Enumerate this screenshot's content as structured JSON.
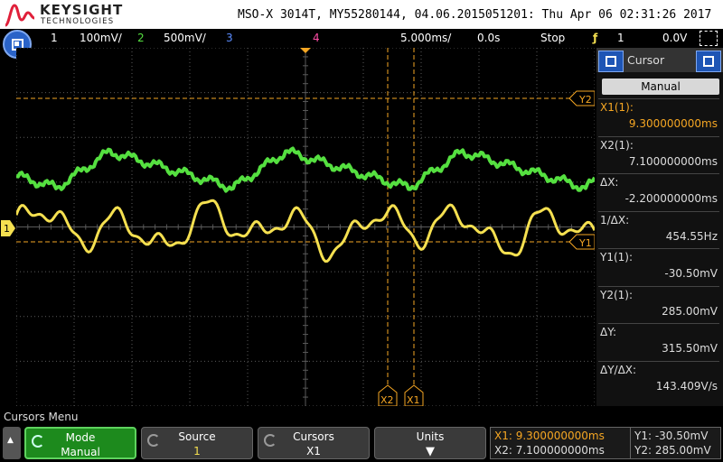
{
  "brand": {
    "name": "KEYSIGHT",
    "sub": "TECHNOLOGIES"
  },
  "title": "MSO-X 3014T, MY55280144, 04.06.2015051201: Thu Apr 06 02:31:26 2017",
  "channels": [
    {
      "num": "1",
      "scale": "100mV/",
      "color": "#f5e050"
    },
    {
      "num": "2",
      "scale": "500mV/",
      "color": "#55e040"
    },
    {
      "num": "3",
      "color": "#5b8cff"
    },
    {
      "num": "4",
      "color": "#ff4da6"
    }
  ],
  "timebase": {
    "scale": "5.000ms/",
    "delay": "0.0s"
  },
  "run_state": "Stop",
  "trigger": {
    "icon": "trigger-rising-edge-icon",
    "source": "1",
    "level": "0.0V"
  },
  "markers": {
    "y2": "Y2",
    "y1": "Y1",
    "x1": "X1",
    "x2": "X2",
    "ch_ground": "1"
  },
  "panel": {
    "title": "Cursor",
    "mode": "Manual",
    "rows": [
      {
        "label": "X1(1):",
        "value": "9.300000000ms"
      },
      {
        "label": "X2(1):",
        "value": "7.100000000ms"
      },
      {
        "label": "ΔX:",
        "value": "-2.200000000ms"
      },
      {
        "label": "1/ΔX:",
        "value": "454.55Hz"
      },
      {
        "label": "Y1(1):",
        "value": "-30.50mV"
      },
      {
        "label": "Y2(1):",
        "value": "285.00mV"
      },
      {
        "label": "ΔY:",
        "value": "315.50mV"
      },
      {
        "label": "ΔY/ΔX:",
        "value": "143.409V/s"
      }
    ]
  },
  "menu": {
    "title": "Cursors Menu",
    "softkeys": [
      {
        "label": "Mode",
        "value": "Manual"
      },
      {
        "label": "Source",
        "value": "1"
      },
      {
        "label": "Cursors",
        "value": "X1"
      },
      {
        "label": "Units",
        "value": ""
      }
    ]
  },
  "readout": {
    "x1": "X1: 9.300000000ms",
    "x2": "X2: 7.100000000ms",
    "y1": "Y1: -30.50mV",
    "y2": "Y2: 285.00mV"
  },
  "colors": {
    "ch1": "#f5e050",
    "ch2": "#55e040",
    "cursor": "#f5a623",
    "grid": "#5a5a5a"
  }
}
